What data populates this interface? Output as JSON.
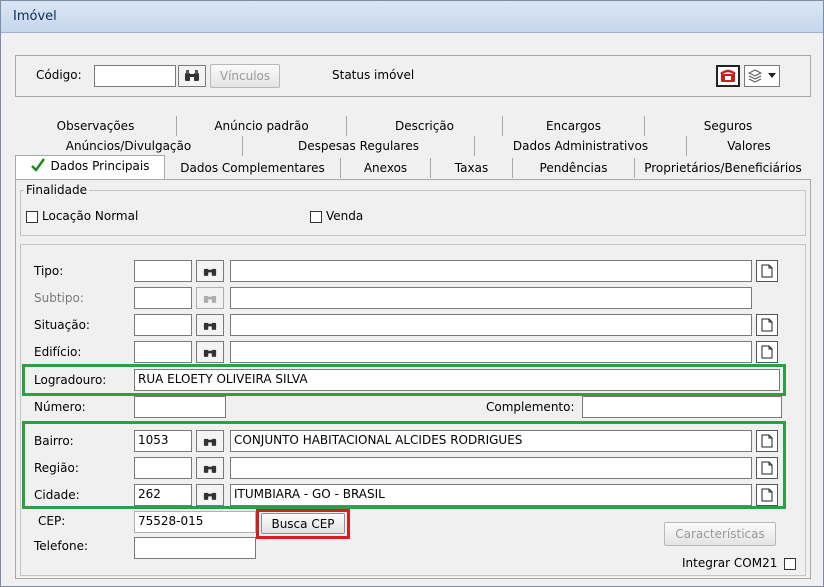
{
  "window": {
    "title": "Imóvel"
  },
  "top": {
    "codigo_label": "Código:",
    "codigo_value": "",
    "vinculos_label": "Vínculos",
    "status_label": "Status imóvel"
  },
  "tabs": {
    "row1": [
      "Observações",
      "Anúncio padrão",
      "Descrição",
      "Encargos",
      "Seguros"
    ],
    "row2": [
      "Anúncios/Divulgação",
      "Despesas Regulares",
      "Dados Administrativos",
      "Valores"
    ],
    "row3": [
      "Dados Principais",
      "Dados Complementares",
      "Anexos",
      "Taxas",
      "Pendências",
      "Proprietários/Beneficiários"
    ]
  },
  "finalidade": {
    "legend": "Finalidade",
    "locacao_label": "Locação Normal",
    "venda_label": "Venda"
  },
  "fields": {
    "tipo": {
      "label": "Tipo:",
      "code": "",
      "desc": ""
    },
    "subtipo": {
      "label": "Subtipo:",
      "code": "",
      "desc": ""
    },
    "situacao": {
      "label": "Situação:",
      "code": "",
      "desc": ""
    },
    "edificio": {
      "label": "Edifício:",
      "code": "",
      "desc": ""
    },
    "logradouro": {
      "label": "Logradouro:",
      "value": "RUA ELOETY OLIVEIRA SILVA"
    },
    "numero": {
      "label": "Número:",
      "value": ""
    },
    "complemento": {
      "label": "Complemento:",
      "value": ""
    },
    "bairro": {
      "label": "Bairro:",
      "code": "1053",
      "desc": "CONJUNTO HABITACIONAL ALCIDES RODRIGUES"
    },
    "regiao": {
      "label": "Região:",
      "code": "",
      "desc": ""
    },
    "cidade": {
      "label": "Cidade:",
      "code": "262",
      "desc": "ITUMBIARA - GO - BRASIL"
    },
    "cep": {
      "label": "CEP:",
      "value": "75528-015"
    },
    "telefone": {
      "label": "Telefone:",
      "value": ""
    }
  },
  "buttons": {
    "busca_cep": "Busca CEP",
    "caracteristicas": "Características",
    "integrar_label": "Integrar COM21"
  },
  "colors": {
    "highlight_green": "#2e9e44",
    "highlight_red": "#d22020",
    "check_green": "#1b8a1b"
  }
}
